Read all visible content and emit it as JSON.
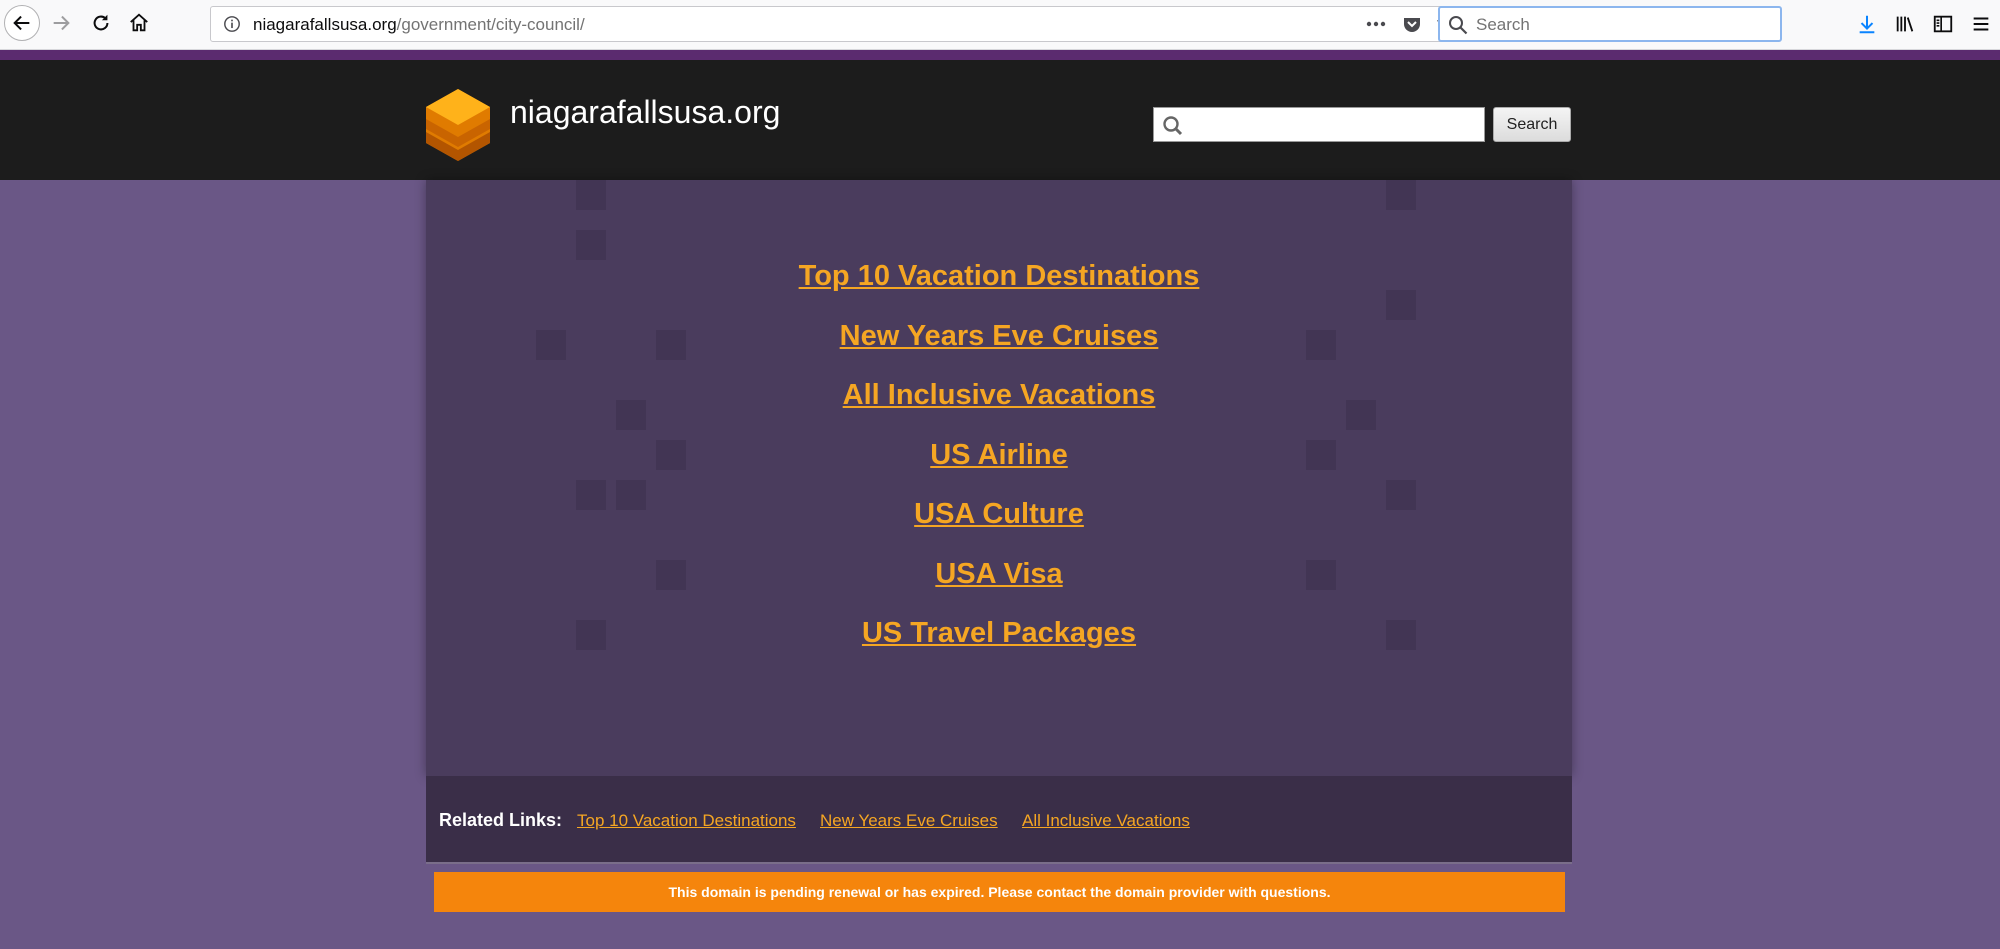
{
  "browser": {
    "url_domain": "niagarafallsusa.org",
    "url_path": "/government/city-council/",
    "search_placeholder": "Search"
  },
  "site": {
    "title": "niagarafallsusa.org",
    "search_button": "Search",
    "links": [
      "Top 10 Vacation Destinations",
      "New Years Eve Cruises",
      "All Inclusive Vacations",
      "US Airline",
      "USA Culture",
      "USA Visa",
      "US Travel Packages"
    ],
    "related_label": "Related Links:",
    "related_links": [
      "Top 10 Vacation Destinations",
      "New Years Eve Cruises",
      "All Inclusive Vacations"
    ],
    "notice": "This domain is pending renewal or has expired. Please contact the domain provider with questions."
  },
  "colors": {
    "link": "#f5a623",
    "header": "#1c1c1c",
    "page_bg": "#6a5786",
    "notice_bg": "#f5850c"
  }
}
